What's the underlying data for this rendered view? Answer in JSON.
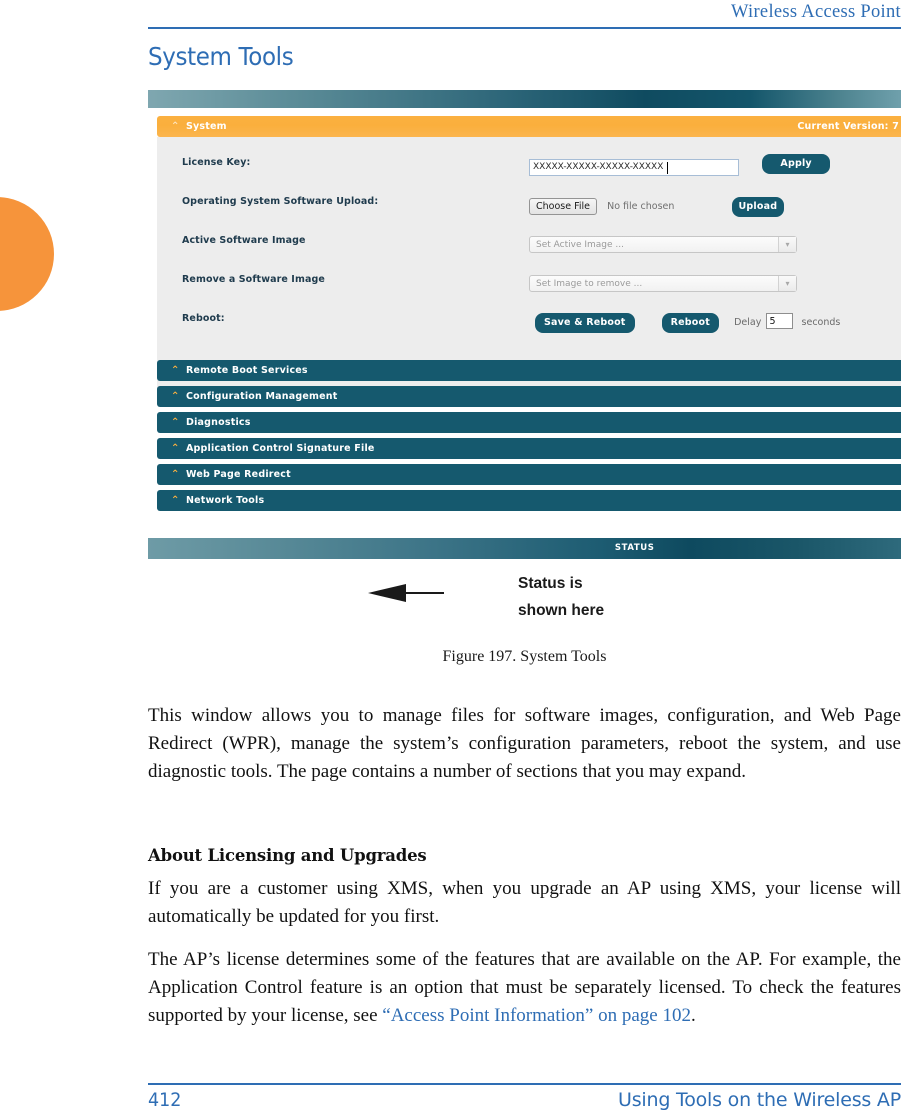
{
  "page": {
    "running_header": "Wireless Access Point",
    "title": "System Tools",
    "footer_page_number": "412",
    "footer_title": "Using Tools on the Wireless AP"
  },
  "figure": {
    "caption": "Figure 197. System Tools",
    "annotation_line1": "Status is",
    "annotation_line2": "shown here",
    "status_bar_label": "STATUS",
    "system_section": {
      "title": "System",
      "chevron": "⌃",
      "current_version": "Current Version: 7",
      "rows": [
        {
          "label": "License Key:",
          "input_value": "XXXXX-XXXXX-XXXXX-XXXXX",
          "button": "Apply"
        },
        {
          "label": "Operating System Software Upload:",
          "file_button": "Choose File",
          "file_status": "No file chosen",
          "button": "Upload"
        },
        {
          "label": "Active Software Image",
          "select_value": "Set Active Image ..."
        },
        {
          "label": "Remove a Software Image",
          "select_value": "Set Image to remove ..."
        },
        {
          "label": "Reboot:",
          "save_reboot_button": "Save & Reboot",
          "reboot_button": "Reboot",
          "delay_label": "Delay",
          "delay_value": "5",
          "seconds_label": "seconds"
        }
      ]
    },
    "collapsed_sections": [
      {
        "label": "Remote Boot Services",
        "chevron": "⌃"
      },
      {
        "label": "Configuration Management",
        "chevron": "⌃"
      },
      {
        "label": "Diagnostics",
        "chevron": "⌃"
      },
      {
        "label": "Application Control Signature File",
        "chevron": "⌃"
      },
      {
        "label": "Web Page Redirect",
        "chevron": "⌃"
      },
      {
        "label": "Network Tools",
        "chevron": "⌃"
      }
    ]
  },
  "body": {
    "paragraph1": "This window allows you to manage files for software images, configuration, and Web Page Redirect (WPR), manage the system’s configuration parameters, reboot the system, and use diagnostic tools. The page contains a number of sections that you may expand.",
    "subheading": "About Licensing and Upgrades",
    "paragraph2": "If you are a customer using XMS, when you upgrade an AP using XMS, your license will automatically be updated for you first.",
    "paragraph3_before": "The AP’s license determines some of the features that are available on the AP. For example, the Application Control feature is an option that must be separately licensed. To check the features supported by your license, see ",
    "paragraph3_link": "“Access Point Information” on page 102",
    "paragraph3_after": "."
  },
  "colors": {
    "brand_blue": "#2E6DB4",
    "teal": "#15596E",
    "orange": "#FBB040",
    "margin_tab_orange": "#F6943B"
  }
}
